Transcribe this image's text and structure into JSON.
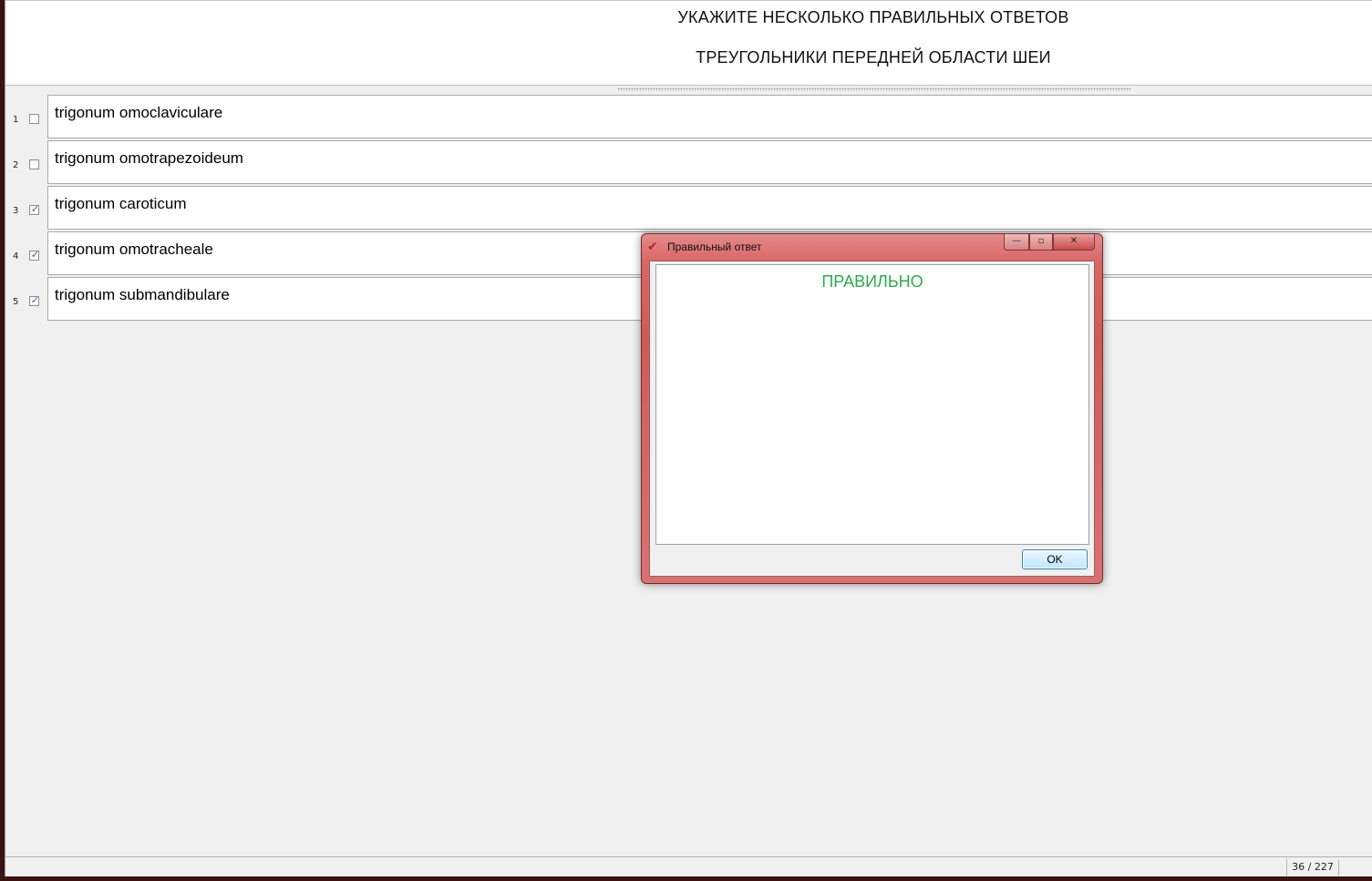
{
  "question": {
    "instruction": "УКАЖИТЕ НЕСКОЛЬКО ПРАВИЛЬНЫХ ОТВЕТОВ",
    "title": "ТРЕУГОЛЬНИКИ ПЕРЕДНЕЙ ОБЛАСТИ ШЕИ"
  },
  "answers": [
    {
      "num": "1",
      "checked": false,
      "mark": "",
      "text": "trigonum omoclaviculare"
    },
    {
      "num": "2",
      "checked": false,
      "mark": "",
      "text": "trigonum omotrapezoideum"
    },
    {
      "num": "3",
      "checked": true,
      "mark": "✓",
      "text": "trigonum caroticum"
    },
    {
      "num": "4",
      "checked": true,
      "mark": "✓",
      "text": "trigonum omotracheale"
    },
    {
      "num": "5",
      "checked": true,
      "mark": "✓",
      "text": "trigonum submandibulare"
    }
  ],
  "status": {
    "counter": "36 / 227"
  },
  "dialog": {
    "title": "Правильный ответ",
    "icon": "check-mark-icon",
    "icon_glyph": "✔",
    "message": "ПРАВИЛЬНО",
    "message_color": "#2bab4c",
    "ok_label": "OK",
    "controls": {
      "minimize": "—",
      "maximize": "▫",
      "close": "✕"
    }
  }
}
